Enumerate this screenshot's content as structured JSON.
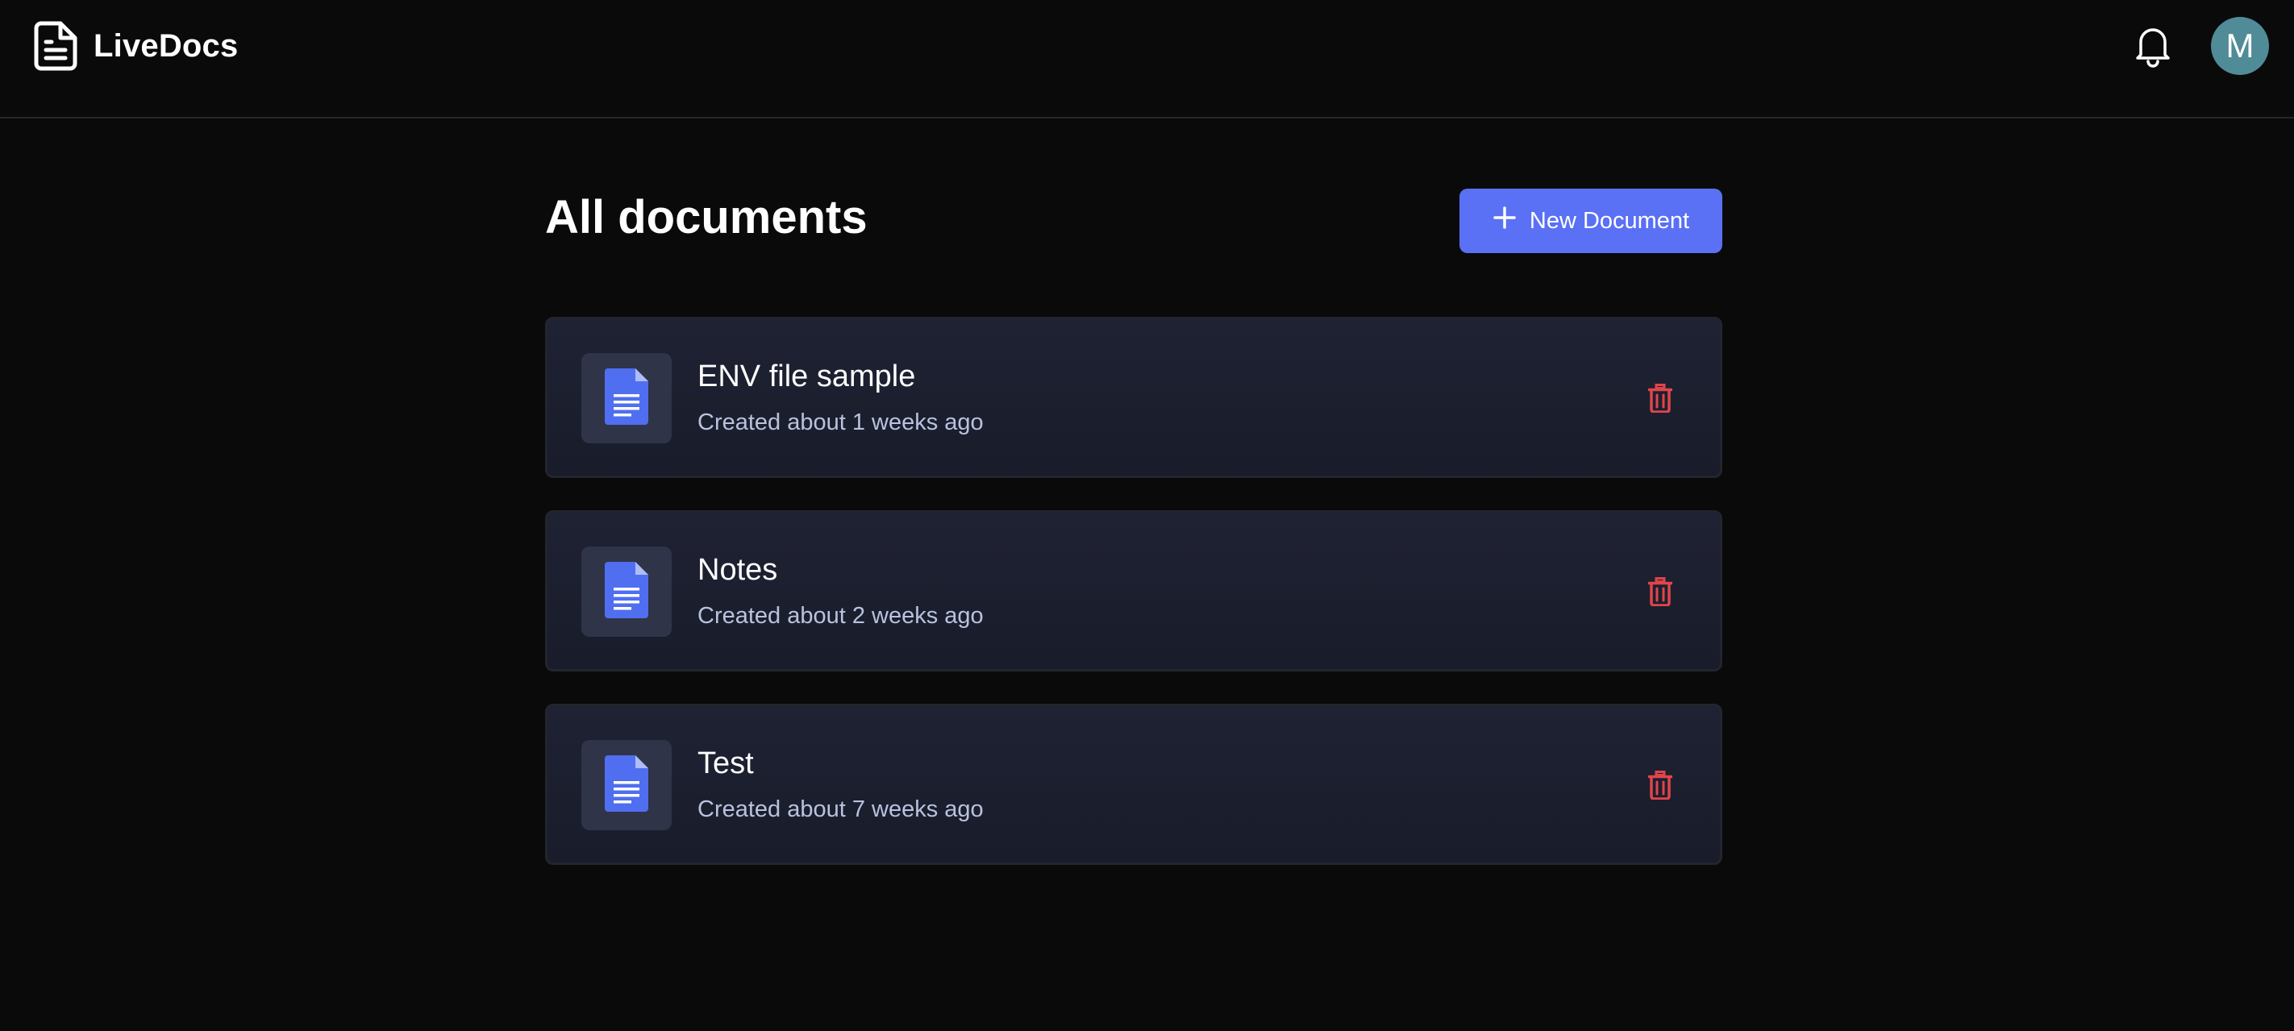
{
  "app": {
    "name": "LiveDocs"
  },
  "header": {
    "avatar_initial": "M"
  },
  "main": {
    "title": "All documents",
    "new_document_label": "New Document"
  },
  "documents": [
    {
      "title": "ENV file sample",
      "meta": "Created about 1 weeks ago"
    },
    {
      "title": "Notes",
      "meta": "Created about 2 weeks ago"
    },
    {
      "title": "Test",
      "meta": "Created about 7 weeks ago"
    }
  ],
  "icons": {
    "logo": "document-icon",
    "notifications": "bell-icon",
    "add": "plus-icon",
    "document": "google-doc-icon",
    "delete": "trash-icon"
  },
  "colors": {
    "background": "#0a0a0a",
    "accent": "#5a70f5",
    "card": "#1f2233",
    "icon_box": "#2f3449",
    "doc_icon": "#4f6ef0",
    "delete": "#e0454b",
    "avatar": "#4f8c98",
    "meta_text": "#b9c2de"
  }
}
